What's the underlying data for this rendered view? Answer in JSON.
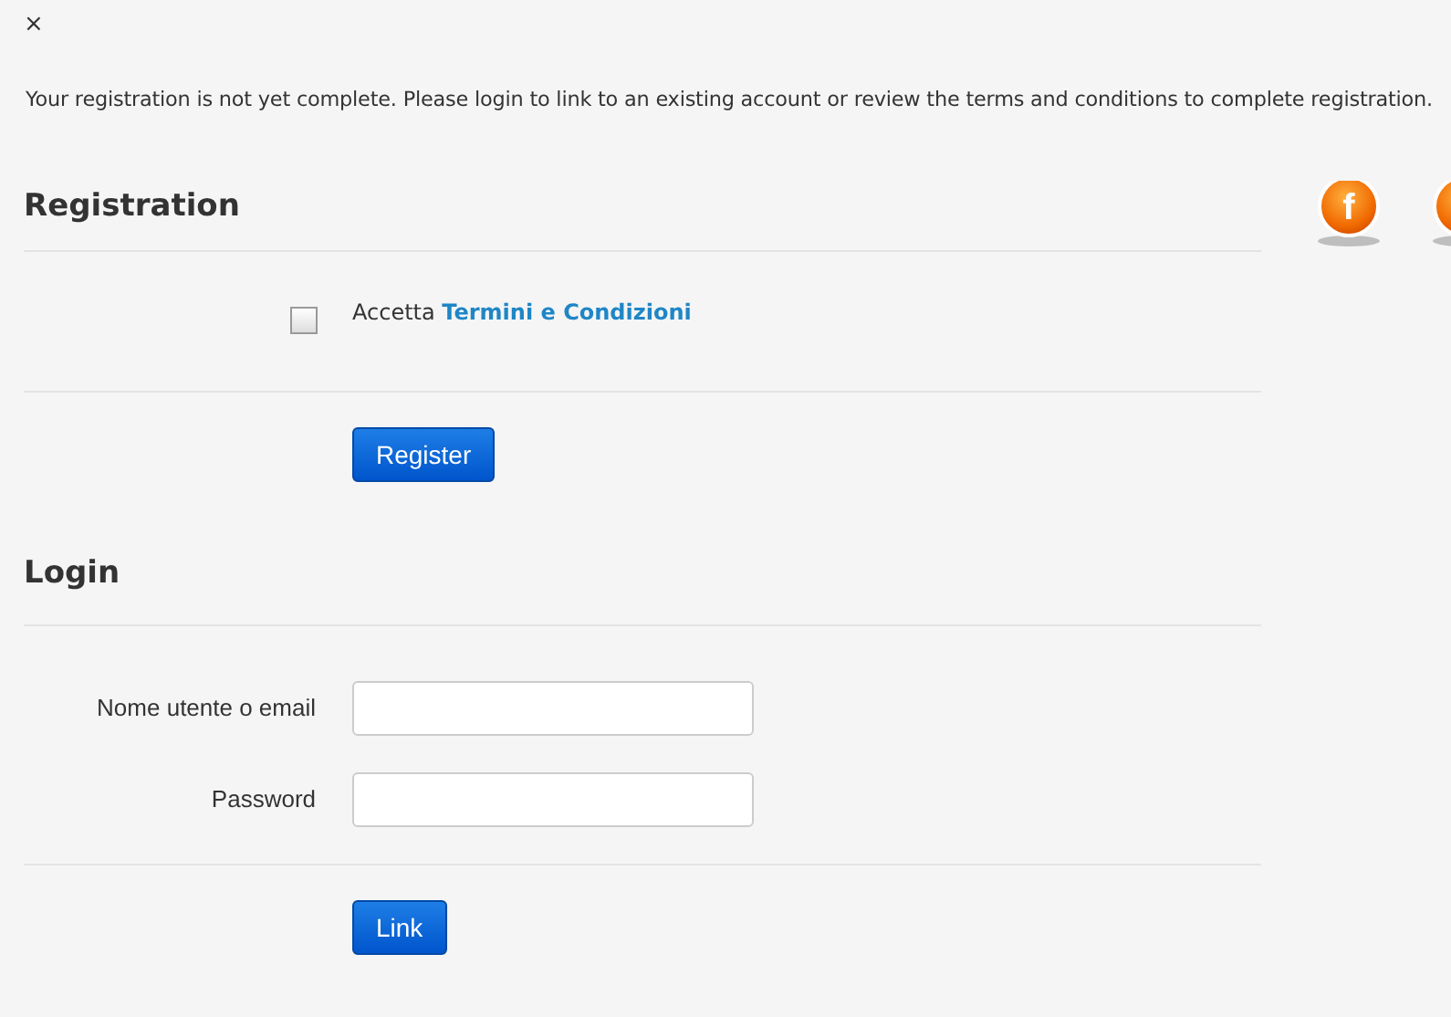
{
  "close": "×",
  "message": "Your registration is not yet complete. Please login to link to an existing account or review the terms and conditions to complete registration.",
  "social_buttons": [
    {
      "glyph": "f",
      "partial": false
    },
    {
      "partial": true
    }
  ],
  "registration": {
    "title": "Registration",
    "terms": {
      "checked": false,
      "prefix": "Accetta",
      "link": "Termini e Condizioni"
    },
    "button": "Register"
  },
  "login": {
    "title": "Login",
    "fields": [
      {
        "label": "Nome utente o email"
      },
      {
        "label": "Password"
      }
    ],
    "button": "Link"
  }
}
